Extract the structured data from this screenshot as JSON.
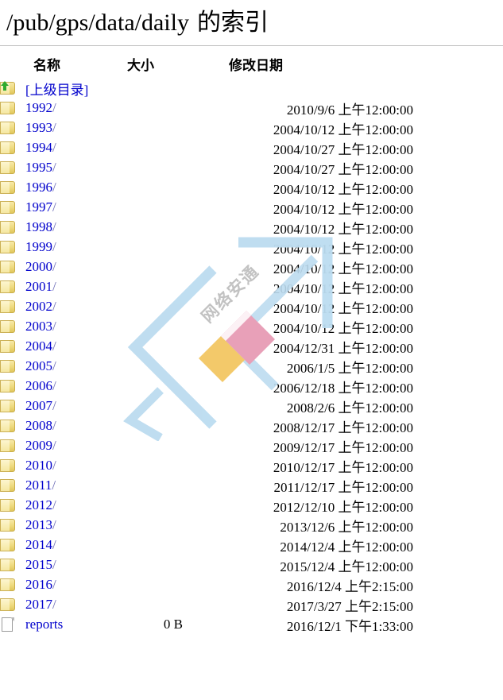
{
  "header": {
    "path": "/pub/gps/data/daily",
    "suffix": "的索引",
    "full_title": "/pub/gps/data/daily 的索引"
  },
  "columns": {
    "name": "名称",
    "size": "大小",
    "date": "修改日期"
  },
  "parent": {
    "label": "[上级目录]",
    "icon": "folder-up-icon"
  },
  "colors": {
    "link": "#0000cc",
    "text": "#000000",
    "rule": "#bfbfbf",
    "folder": "#eed97e",
    "arrow": "#2faa2f",
    "watermark_blue": "#bcdcf0",
    "watermark_pink": "#e8a0b8",
    "watermark_yellow": "#f3c96a"
  },
  "watermark": {
    "text": "网络安通",
    "logo": "diamond-logo"
  },
  "entries": [
    {
      "name": "1992/",
      "size": "",
      "date": "2010/9/6 上午12:00:00",
      "icon": "folder-icon"
    },
    {
      "name": "1993/",
      "size": "",
      "date": "2004/10/12 上午12:00:00",
      "icon": "folder-icon"
    },
    {
      "name": "1994/",
      "size": "",
      "date": "2004/10/27 上午12:00:00",
      "icon": "folder-icon"
    },
    {
      "name": "1995/",
      "size": "",
      "date": "2004/10/27 上午12:00:00",
      "icon": "folder-icon"
    },
    {
      "name": "1996/",
      "size": "",
      "date": "2004/10/12 上午12:00:00",
      "icon": "folder-icon"
    },
    {
      "name": "1997/",
      "size": "",
      "date": "2004/10/12 上午12:00:00",
      "icon": "folder-icon"
    },
    {
      "name": "1998/",
      "size": "",
      "date": "2004/10/12 上午12:00:00",
      "icon": "folder-icon"
    },
    {
      "name": "1999/",
      "size": "",
      "date": "2004/10/12 上午12:00:00",
      "icon": "folder-icon"
    },
    {
      "name": "2000/",
      "size": "",
      "date": "2004/10/12 上午12:00:00",
      "icon": "folder-icon"
    },
    {
      "name": "2001/",
      "size": "",
      "date": "2004/10/12 上午12:00:00",
      "icon": "folder-icon"
    },
    {
      "name": "2002/",
      "size": "",
      "date": "2004/10/12 上午12:00:00",
      "icon": "folder-icon"
    },
    {
      "name": "2003/",
      "size": "",
      "date": "2004/10/12 上午12:00:00",
      "icon": "folder-icon"
    },
    {
      "name": "2004/",
      "size": "",
      "date": "2004/12/31 上午12:00:00",
      "icon": "folder-icon"
    },
    {
      "name": "2005/",
      "size": "",
      "date": "2006/1/5 上午12:00:00",
      "icon": "folder-icon"
    },
    {
      "name": "2006/",
      "size": "",
      "date": "2006/12/18 上午12:00:00",
      "icon": "folder-icon"
    },
    {
      "name": "2007/",
      "size": "",
      "date": "2008/2/6 上午12:00:00",
      "icon": "folder-icon"
    },
    {
      "name": "2008/",
      "size": "",
      "date": "2008/12/17 上午12:00:00",
      "icon": "folder-icon"
    },
    {
      "name": "2009/",
      "size": "",
      "date": "2009/12/17 上午12:00:00",
      "icon": "folder-icon"
    },
    {
      "name": "2010/",
      "size": "",
      "date": "2010/12/17 上午12:00:00",
      "icon": "folder-icon"
    },
    {
      "name": "2011/",
      "size": "",
      "date": "2011/12/17 上午12:00:00",
      "icon": "folder-icon"
    },
    {
      "name": "2012/",
      "size": "",
      "date": "2012/12/10 上午12:00:00",
      "icon": "folder-icon"
    },
    {
      "name": "2013/",
      "size": "",
      "date": "2013/12/6 上午12:00:00",
      "icon": "folder-icon"
    },
    {
      "name": "2014/",
      "size": "",
      "date": "2014/12/4 上午12:00:00",
      "icon": "folder-icon"
    },
    {
      "name": "2015/",
      "size": "",
      "date": "2015/12/4 上午12:00:00",
      "icon": "folder-icon"
    },
    {
      "name": "2016/",
      "size": "",
      "date": "2016/12/4 上午2:15:00",
      "icon": "folder-icon"
    },
    {
      "name": "2017/",
      "size": "",
      "date": "2017/3/27 上午2:15:00",
      "icon": "folder-icon"
    },
    {
      "name": "reports",
      "size": "0 B",
      "date": "2016/12/1 下午1:33:00",
      "icon": "file-icon"
    }
  ]
}
